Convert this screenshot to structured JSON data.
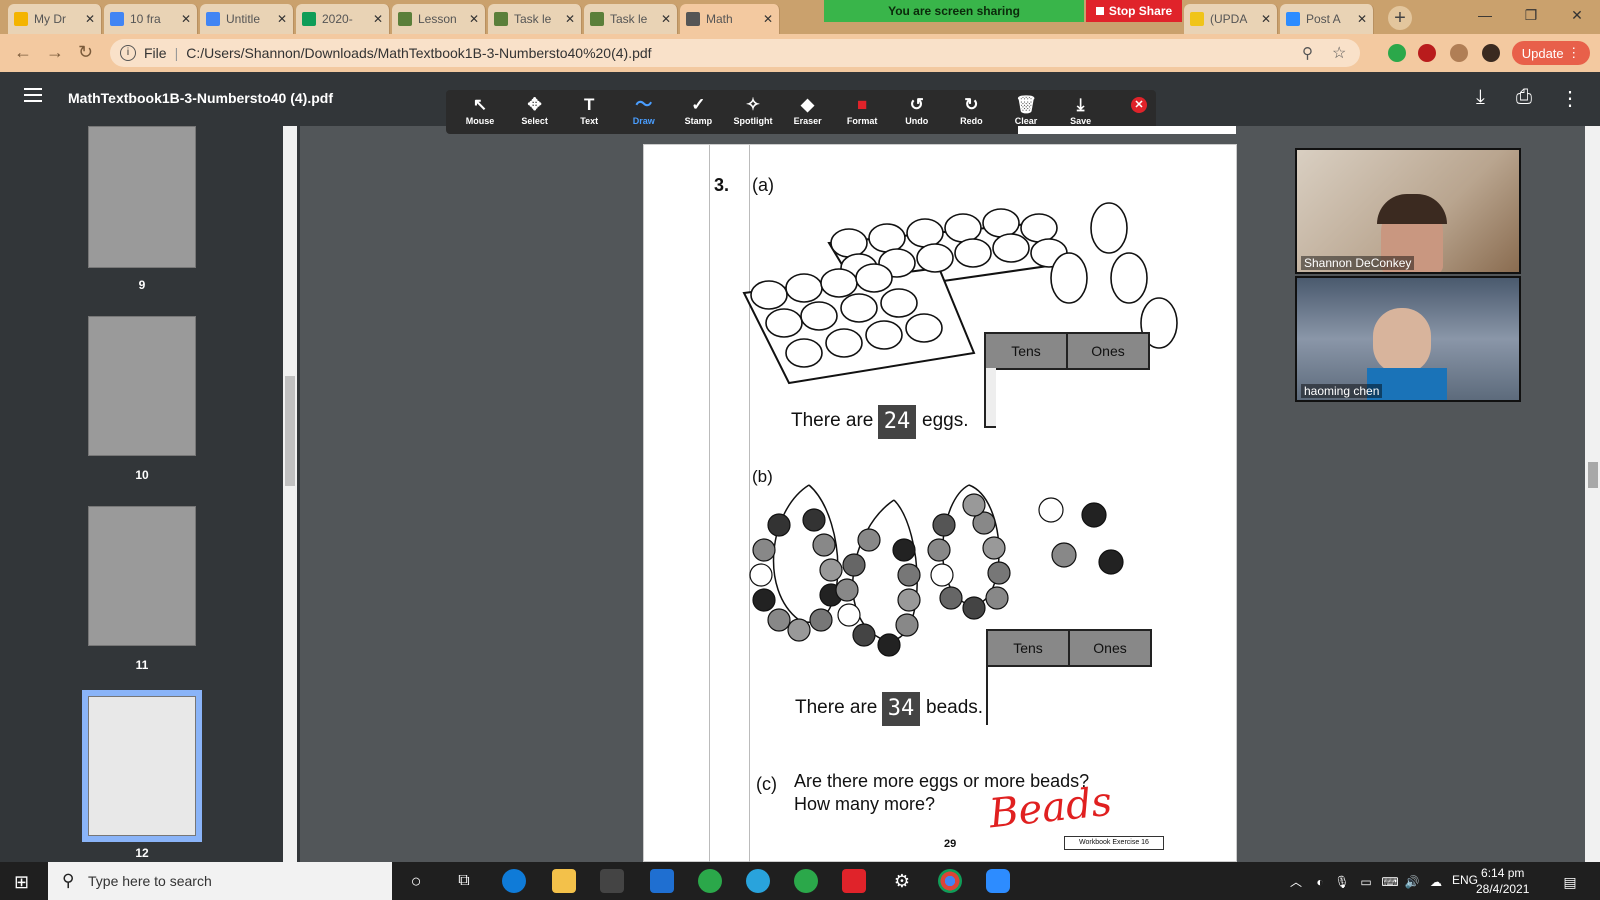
{
  "tabs": [
    {
      "label": "My Dr",
      "color": "#f4b400"
    },
    {
      "label": "10 fra",
      "color": "#4285f4"
    },
    {
      "label": "Untitle",
      "color": "#4285f4"
    },
    {
      "label": "2020-",
      "color": "#0f9d58"
    },
    {
      "label": "Lesson",
      "color": "#5b7f3a"
    },
    {
      "label": "Task le",
      "color": "#5b7f3a"
    },
    {
      "label": "Task le",
      "color": "#5b7f3a"
    },
    {
      "label": "Math",
      "color": "#555555"
    },
    {
      "label": "(UPDA",
      "color": "#f0c419"
    },
    {
      "label": "Post A",
      "color": "#2d8cff"
    }
  ],
  "share": {
    "status": "You are screen sharing",
    "stop": "Stop Share"
  },
  "address": {
    "file_label": "File",
    "url": "C:/Users/Shannon/Downloads/MathTextbook1B-3-Numbersto40%20(4).pdf",
    "update": "Update"
  },
  "pdf": {
    "title": "MathTextbook1B-3-Numbersto40 (4).pdf"
  },
  "annot_tools": [
    {
      "label": "Mouse",
      "icon": "↖",
      "selected": false
    },
    {
      "label": "Select",
      "icon": "✥",
      "selected": false
    },
    {
      "label": "Text",
      "icon": "T",
      "selected": false
    },
    {
      "label": "Draw",
      "icon": "～",
      "selected": true
    },
    {
      "label": "Stamp",
      "icon": "✓",
      "selected": false
    },
    {
      "label": "Spotlight",
      "icon": "✧",
      "selected": false
    },
    {
      "label": "Eraser",
      "icon": "◆",
      "selected": false
    },
    {
      "label": "Format",
      "icon": "■",
      "selected": false
    },
    {
      "label": "Undo",
      "icon": "↺",
      "selected": false
    },
    {
      "label": "Redo",
      "icon": "↻",
      "selected": false
    },
    {
      "label": "Clear",
      "icon": "🗑",
      "selected": false
    },
    {
      "label": "Save",
      "icon": "⤓",
      "selected": false
    }
  ],
  "thumbs": [
    "9",
    "10",
    "11",
    "12"
  ],
  "page": {
    "q_num": "3.",
    "a_label": "(a)",
    "a_text_pre": "There are",
    "a_value": "24",
    "a_text_post": "eggs.",
    "tens": "Tens",
    "ones": "Ones",
    "b_label": "(b)",
    "b_text_pre": "There are",
    "b_value": "34",
    "b_text_post": "beads.",
    "c_label": "(c)",
    "c_line1": "Are there more eggs or more beads?",
    "c_line2": "How many more?",
    "page_no": "29",
    "workbook": "Workbook Exercise 16",
    "handwriting": "Beads"
  },
  "participants": [
    {
      "name": "Shannon DeConkey"
    },
    {
      "name": "haoming chen"
    }
  ],
  "taskbar": {
    "search_placeholder": "Type here to search",
    "lang": "ENG",
    "time": "6:14 pm",
    "date": "28/4/2021"
  }
}
